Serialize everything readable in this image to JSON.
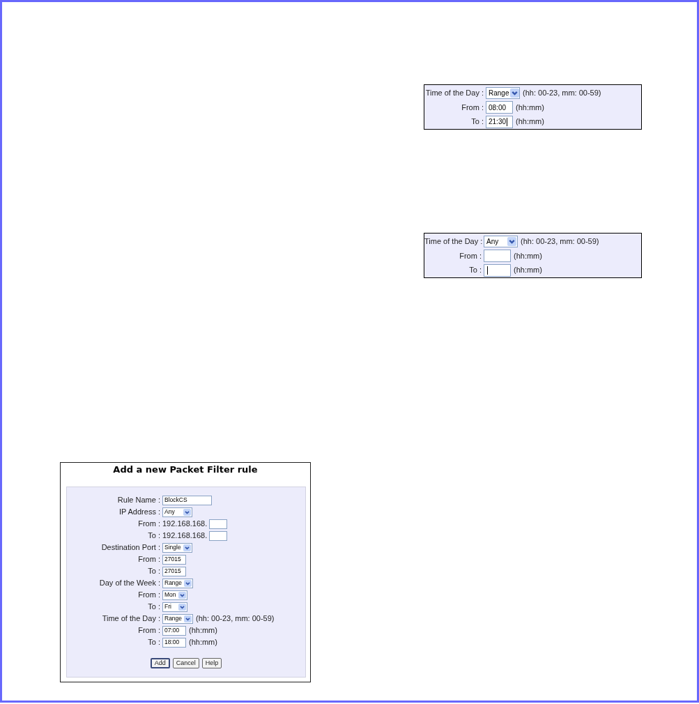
{
  "time_panels": [
    {
      "rows": [
        {
          "kind": "select",
          "label": "Time of the Day :",
          "value": "Range",
          "hint": "(hh: 00-23, mm: 00-59)"
        },
        {
          "kind": "text",
          "label": "From :",
          "value": "08:00",
          "hint": "(hh:mm)",
          "focused": false
        },
        {
          "kind": "text",
          "label": "To :",
          "value": "21:30",
          "hint": "(hh:mm)",
          "focused": true
        }
      ]
    },
    {
      "rows": [
        {
          "kind": "select",
          "label": "Time of the Day :",
          "value": "Any",
          "hint": "(hh: 00-23, mm: 00-59)"
        },
        {
          "kind": "text",
          "label": "From :",
          "hint": "(hh:mm)",
          "focused": false
        },
        {
          "kind": "text",
          "label": "To :",
          "hint": "(hh:mm)",
          "focused": true
        }
      ]
    }
  ],
  "packet_filter_form": {
    "title": "Add a new Packet Filter rule",
    "rows": [
      {
        "kind": "text",
        "label": "Rule Name :",
        "value": "BlockCS"
      },
      {
        "kind": "select",
        "label": "IP Address :",
        "value": "Any"
      },
      {
        "kind": "ip",
        "label": "From :",
        "prefix": "192.168.168."
      },
      {
        "kind": "ip",
        "label": "To :",
        "prefix": "192.168.168."
      },
      {
        "kind": "select",
        "label": "Destination Port :",
        "value": "Single"
      },
      {
        "kind": "text",
        "label": "From :",
        "value": "27015"
      },
      {
        "kind": "text",
        "label": "To :",
        "value": "27015"
      },
      {
        "kind": "select",
        "label": "Day of the Week :",
        "value": "Range"
      },
      {
        "kind": "select",
        "label": "From :",
        "value": "Mon"
      },
      {
        "kind": "select",
        "label": "To :",
        "value": "Fri"
      },
      {
        "kind": "select",
        "label": "Time of the Day :",
        "value": "Range",
        "hint": "(hh: 00-23, mm: 00-59)"
      },
      {
        "kind": "text",
        "label": "From :",
        "value": "07:00",
        "hint": "(hh:mm)"
      },
      {
        "kind": "text",
        "label": "To :",
        "value": "18:00",
        "hint": "(hh:mm)"
      }
    ],
    "buttons": [
      "Add",
      "Cancel",
      "Help"
    ]
  }
}
